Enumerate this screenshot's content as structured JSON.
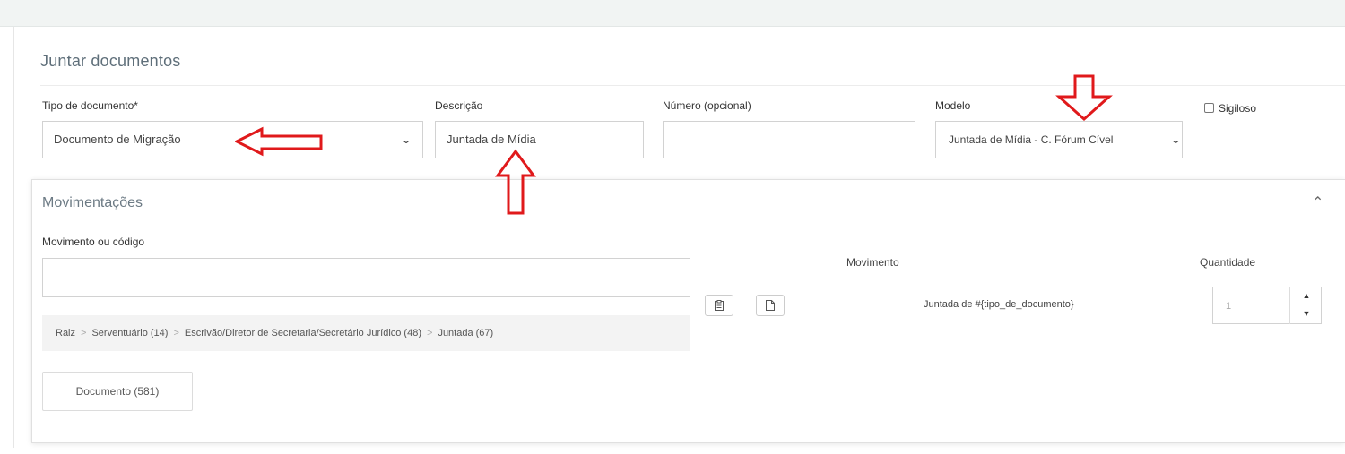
{
  "form": {
    "title": "Juntar documentos",
    "tipo": {
      "label": "Tipo de documento*",
      "value": "Documento de Migração"
    },
    "descricao": {
      "label": "Descrição",
      "value": "Juntada de Mídia"
    },
    "numero": {
      "label": "Número (opcional)",
      "value": ""
    },
    "modelo": {
      "label": "Modelo",
      "value": "Juntada de Mídia - C. Fórum Cível"
    },
    "sigiloso": {
      "label": "Sigiloso",
      "checked": false
    }
  },
  "movimentacoes": {
    "title": "Movimentações",
    "search_label": "Movimento ou código",
    "search_value": "",
    "breadcrumb": [
      "Raiz",
      "Serventuário (14)",
      "Escrivão/Diretor de Secretaria/Secretário Jurídico (48)",
      "Juntada (67)"
    ],
    "document_button": "Documento (581)",
    "table": {
      "headers": {
        "movimento": "Movimento",
        "quantidade": "Quantidade"
      },
      "rows": [
        {
          "movimento": "Juntada de #{tipo_de_documento}",
          "quantidade": "1"
        }
      ]
    }
  },
  "colors": {
    "annotation_arrow": "#e0191b",
    "title_text": "#5f6f7a"
  },
  "icons": [
    "chevron-down-icon",
    "chevron-up-icon",
    "clipboard-icon",
    "document-icon",
    "spin-up-icon",
    "spin-down-icon",
    "annotation-arrow-icon"
  ]
}
